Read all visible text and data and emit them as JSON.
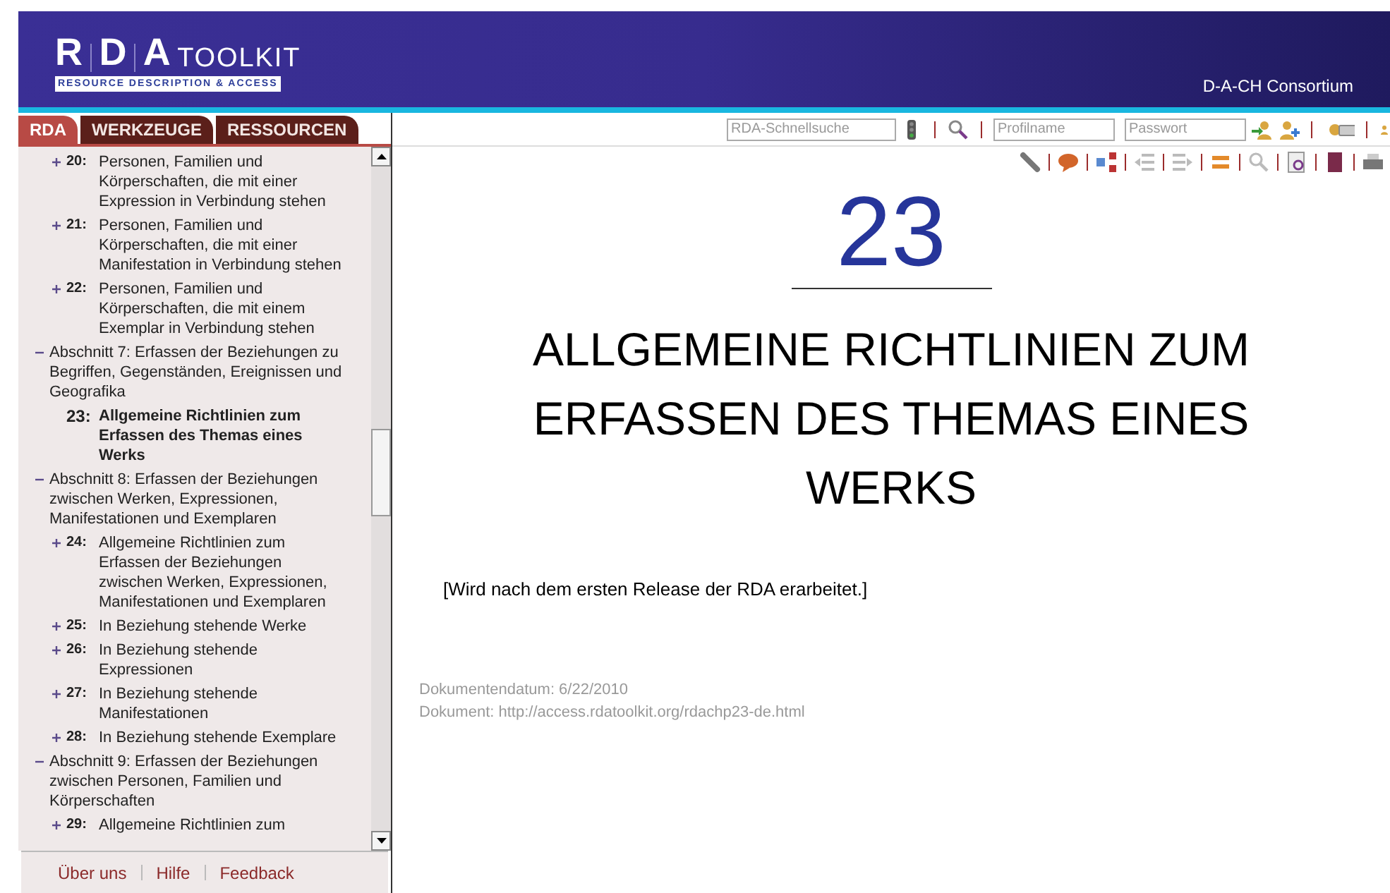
{
  "header": {
    "logo_letters": [
      "R",
      "D",
      "A"
    ],
    "logo_word": "TOOLKIT",
    "logo_subtitle": "RESOURCE DESCRIPTION & ACCESS",
    "consortium": "D-A-CH Consortium"
  },
  "tabs": [
    {
      "label": "RDA",
      "selected": true
    },
    {
      "label": "WERKZEUGE",
      "selected": false
    },
    {
      "label": "RESSOURCEN",
      "selected": false
    }
  ],
  "toolbar": {
    "search_placeholder": "RDA-Schnellsuche",
    "profile_placeholder": "Profilname",
    "password_placeholder": "Passwort"
  },
  "tree": [
    {
      "kind": "chapter",
      "number": "20:",
      "title": "Personen, Familien und Körperschaften, die mit einer Expression in Verbindung stehen",
      "selected": false
    },
    {
      "kind": "chapter",
      "number": "21:",
      "title": "Personen, Familien und Körperschaften, die mit einer Manifestation in Verbindung stehen",
      "selected": false
    },
    {
      "kind": "chapter",
      "number": "22:",
      "title": "Personen, Familien und Körperschaften, die mit einem Exemplar in Verbindung stehen",
      "selected": false
    },
    {
      "kind": "section",
      "title": "Abschnitt 7: Erfassen der Beziehungen zu Begriffen, Gegenständen, Ereignissen und Geografika",
      "children": [
        {
          "kind": "chapter",
          "number": "23:",
          "title": "Allgemeine Richtlinien zum Erfassen des Themas eines Werks",
          "selected": true
        }
      ]
    },
    {
      "kind": "section",
      "title": "Abschnitt 8: Erfassen der Beziehungen zwischen Werken, Expressionen, Manifestationen und Exemplaren",
      "children": [
        {
          "kind": "chapter",
          "number": "24:",
          "title": "Allgemeine Richtlinien zum Erfassen der Beziehungen zwischen Werken, Expressionen, Manifestationen und Exemplaren",
          "selected": false
        },
        {
          "kind": "chapter",
          "number": "25:",
          "title": "In Beziehung stehende Werke",
          "selected": false
        },
        {
          "kind": "chapter",
          "number": "26:",
          "title": "In Beziehung stehende Expressionen",
          "selected": false
        },
        {
          "kind": "chapter",
          "number": "27:",
          "title": "In Beziehung stehende Manifestationen",
          "selected": false
        },
        {
          "kind": "chapter",
          "number": "28:",
          "title": "In Beziehung stehende Exemplare",
          "selected": false
        }
      ]
    },
    {
      "kind": "section",
      "title": "Abschnitt 9: Erfassen der Beziehungen zwischen Personen, Familien und Körperschaften",
      "children": [
        {
          "kind": "chapter",
          "number": "29:",
          "title": "Allgemeine Richtlinien zum",
          "selected": false
        }
      ]
    }
  ],
  "footer_links": [
    "Über uns",
    "Hilfe",
    "Feedback"
  ],
  "document": {
    "chapter_number": "23",
    "title": "ALLGEMEINE RICHTLINIEN ZUM ERFASSEN DES THEMAS EINES WERKS",
    "body": "[Wird nach dem ersten Release der RDA erarbeitet.]",
    "date": "Dokumentendatum: 6/22/2010",
    "url": "Dokument: http://access.rdatoolkit.org/rdachp23-de.html"
  }
}
